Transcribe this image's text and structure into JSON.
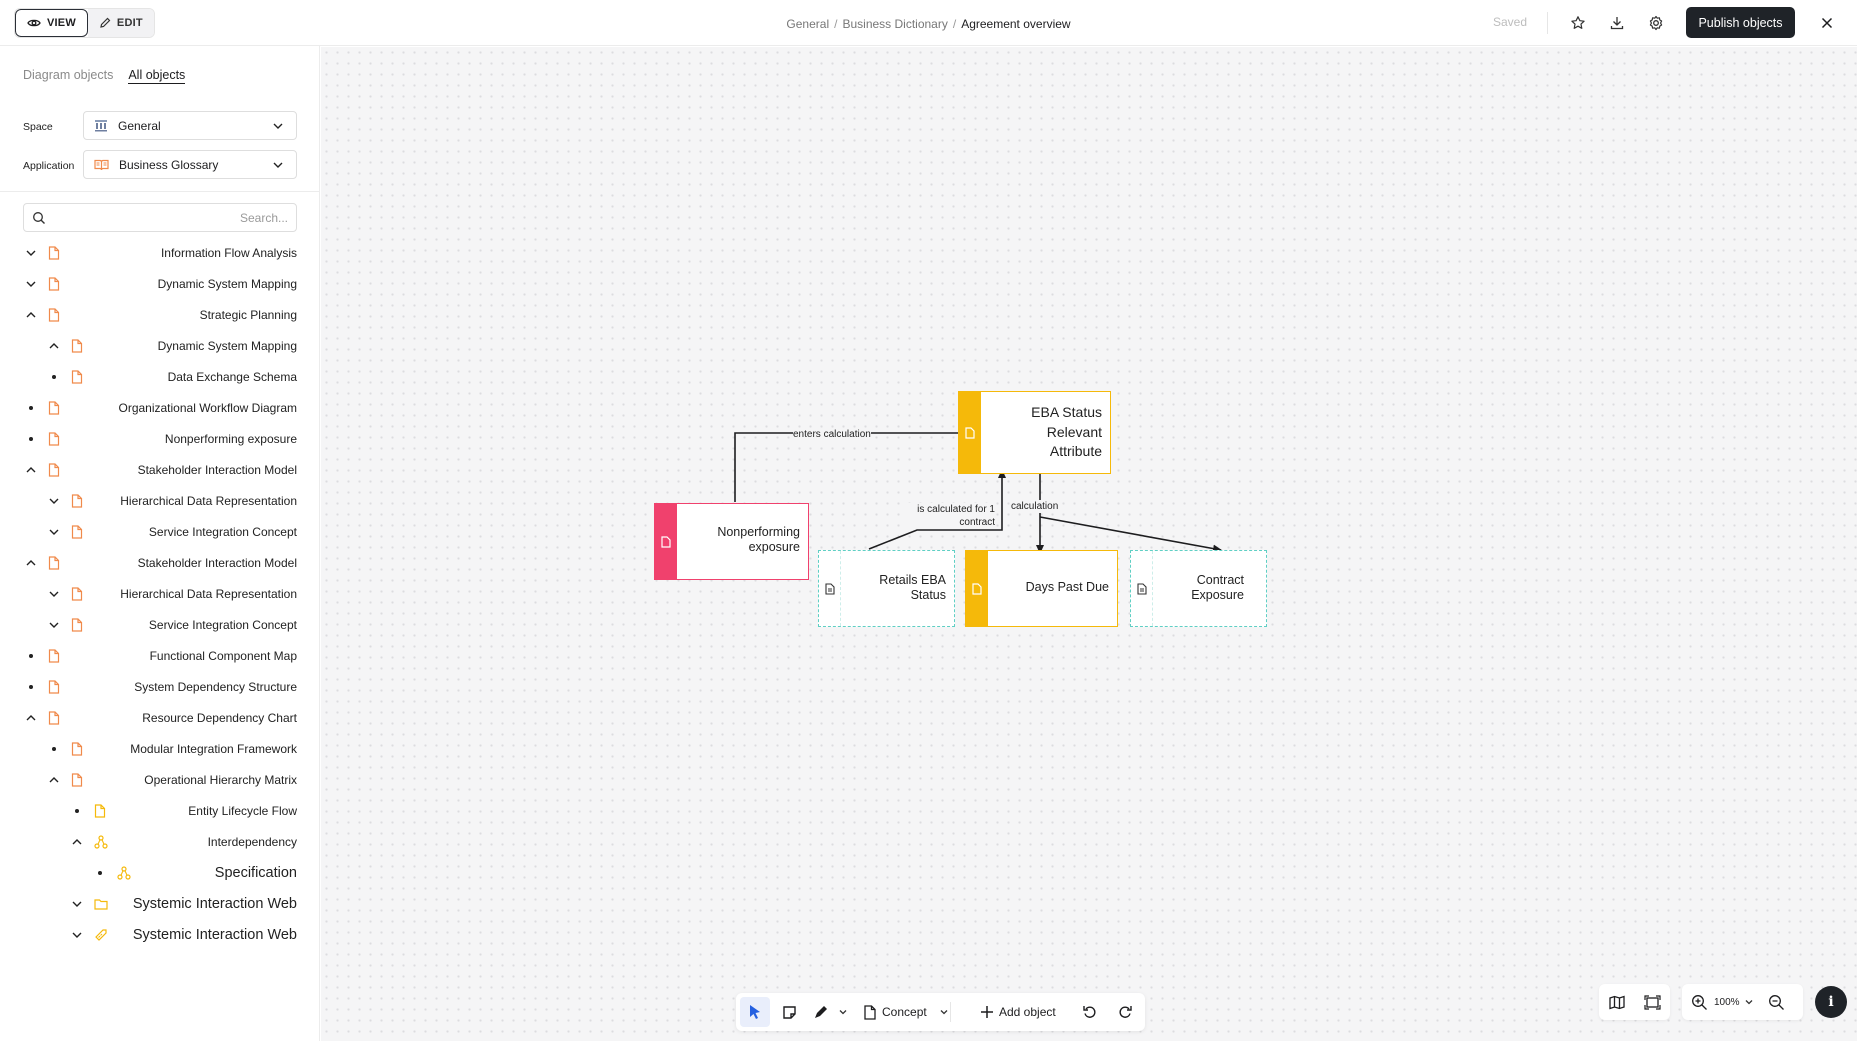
{
  "topbar": {
    "view_label": "VIEW",
    "edit_label": "EDIT",
    "breadcrumb": [
      "General",
      "Business Dictionary",
      "Agreement overview"
    ],
    "saved_label": "Saved",
    "publish_label": "Publish objects"
  },
  "sidebar": {
    "tabs": [
      "Diagram objects",
      "All objects"
    ],
    "space_label": "Space",
    "space_value": "General",
    "application_label": "Application",
    "application_value": "Business Glossary",
    "search_placeholder": "Search...",
    "tree": [
      {
        "label": "Information Flow Analysis",
        "toggle": "chevron-down",
        "icon": "doc"
      },
      {
        "label": "Dynamic System Mapping",
        "toggle": "chevron-down",
        "icon": "doc"
      },
      {
        "label": "Strategic Planning",
        "toggle": "chevron-up",
        "icon": "doc"
      },
      {
        "label": "Dynamic System Mapping",
        "toggle": "chevron-up",
        "icon": "doc"
      },
      {
        "label": "Data Exchange Schema",
        "toggle": "dot",
        "icon": "doc"
      },
      {
        "label": "Organizational Workflow Diagram",
        "toggle": "dot",
        "icon": "doc"
      },
      {
        "label": "Nonperforming exposure",
        "toggle": "dot",
        "icon": "doc"
      },
      {
        "label": "Stakeholder Interaction Model",
        "toggle": "chevron-up",
        "icon": "doc"
      },
      {
        "label": "Hierarchical Data Representation",
        "toggle": "chevron-down",
        "icon": "doc"
      },
      {
        "label": "Service Integration Concept",
        "toggle": "chevron-down",
        "icon": "doc"
      },
      {
        "label": "Stakeholder Interaction Model",
        "toggle": "chevron-up",
        "icon": "doc"
      },
      {
        "label": "Hierarchical Data Representation",
        "toggle": "chevron-down",
        "icon": "doc"
      },
      {
        "label": "Service Integration Concept",
        "toggle": "chevron-down",
        "icon": "doc"
      },
      {
        "label": "Functional Component Map",
        "toggle": "dot",
        "icon": "doc"
      },
      {
        "label": "System Dependency Structure",
        "toggle": "dot",
        "icon": "doc"
      },
      {
        "label": "Resource Dependency Chart",
        "toggle": "chevron-up",
        "icon": "doc"
      },
      {
        "label": "Modular Integration Framework",
        "toggle": "dot",
        "icon": "doc"
      },
      {
        "label": "Operational Hierarchy Matrix",
        "toggle": "chevron-up",
        "icon": "doc"
      },
      {
        "label": "Entity Lifecycle Flow",
        "toggle": "dot",
        "icon": "doc-yellow"
      },
      {
        "label": "Interdependency",
        "toggle": "chevron-up",
        "icon": "network"
      },
      {
        "label": "Specification",
        "toggle": "dot",
        "icon": "network"
      },
      {
        "label": "Systemic Interaction Web",
        "toggle": "chevron-down",
        "icon": "folder"
      },
      {
        "label": "Systemic Interaction Web",
        "toggle": "chevron-down",
        "icon": "tag"
      }
    ]
  },
  "diagram": {
    "nodes": {
      "eba": [
        "EBA Status",
        "Relevant",
        "Attribute"
      ],
      "npe": [
        "Nonperforming",
        "exposure"
      ],
      "retails": [
        "Retails EBA",
        "Status"
      ],
      "dpd": [
        "Days Past Due"
      ],
      "contract": [
        "Contract",
        "Exposure"
      ]
    },
    "edges": {
      "enters": "enters calculation",
      "calc_for": [
        "is calculated for 1",
        "contract"
      ],
      "calculation": "calculation"
    }
  },
  "toolbar": {
    "concept_label": "Concept",
    "add_object_label": "Add object",
    "zoom_label": "100%"
  },
  "colors": {
    "orange_icon": "#f08a4b",
    "pink": "#f0416d",
    "yellow": "#f5b90a",
    "teal": "#5fcfc4",
    "dark": "#1f2328"
  }
}
